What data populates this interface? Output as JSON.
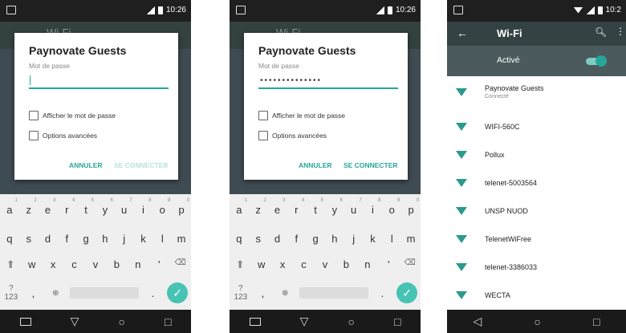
{
  "status": {
    "time": "10:26",
    "time_short": "10:2"
  },
  "dialog": {
    "title": "Paynovate Guests",
    "password_label": "Mot de passe",
    "password_masked": "••••••••••••••",
    "show_password": "Afficher le mot de passe",
    "advanced": "Options avancées",
    "cancel": "ANNULER",
    "connect": "SE CONNECTER"
  },
  "background": {
    "title": "Wi-Fi"
  },
  "keyboard": {
    "row1": [
      "a",
      "z",
      "e",
      "r",
      "t",
      "y",
      "u",
      "i",
      "o",
      "p"
    ],
    "row1_nums": [
      "1",
      "2",
      "3",
      "4",
      "5",
      "6",
      "7",
      "8",
      "9",
      "0"
    ],
    "row2": [
      "q",
      "s",
      "d",
      "f",
      "g",
      "h",
      "j",
      "k",
      "l",
      "m"
    ],
    "row3": [
      "w",
      "x",
      "c",
      "v",
      "b",
      "n",
      "'"
    ],
    "sym": "?123",
    "comma": ",",
    "period": "."
  },
  "wifi_screen": {
    "title": "Wi-Fi",
    "toggle_label": "Activé",
    "networks": [
      {
        "name": "Paynovate Guests",
        "status": "Connecté"
      },
      {
        "name": "WIFI-560C"
      },
      {
        "name": "Pollux"
      },
      {
        "name": "telenet-5003564"
      },
      {
        "name": "UNSP NUOD"
      },
      {
        "name": "TelenetWiFree"
      },
      {
        "name": "telenet-3386033"
      },
      {
        "name": "WECTA"
      }
    ]
  },
  "icons": {
    "back": "back-arrow-icon",
    "search": "search-icon",
    "more": "more-vert-icon",
    "wifi": "wifi-signal-icon",
    "enter": "check-icon",
    "shift": "shift-icon",
    "backspace": "backspace-icon",
    "globe": "globe-icon"
  },
  "colors": {
    "accent": "#26a69a",
    "appbar": "#354244",
    "disabled": "#b7e2dd"
  }
}
